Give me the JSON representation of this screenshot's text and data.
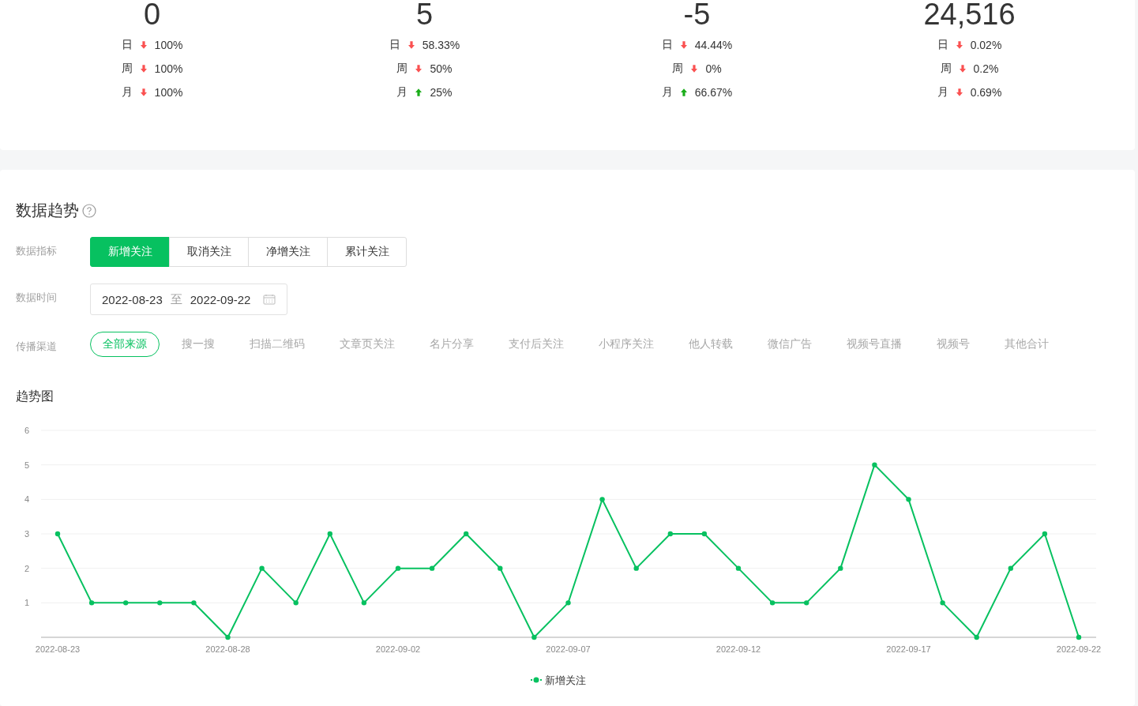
{
  "stats": [
    {
      "value": "0",
      "changes": [
        {
          "period": "日",
          "kind": "down",
          "value": "100%"
        },
        {
          "period": "周",
          "kind": "down",
          "value": "100%"
        },
        {
          "period": "月",
          "kind": "down",
          "value": "100%"
        }
      ]
    },
    {
      "value": "5",
      "changes": [
        {
          "period": "日",
          "kind": "down",
          "value": "58.33%"
        },
        {
          "period": "周",
          "kind": "down",
          "value": "50%"
        },
        {
          "period": "月",
          "kind": "up",
          "value": "25%"
        }
      ]
    },
    {
      "value": "-5",
      "changes": [
        {
          "period": "日",
          "kind": "down",
          "value": "44.44%"
        },
        {
          "period": "周",
          "kind": "down",
          "value": "0%"
        },
        {
          "period": "月",
          "kind": "up",
          "value": "66.67%"
        }
      ]
    },
    {
      "value": "24,516",
      "changes": [
        {
          "period": "日",
          "kind": "down",
          "value": "0.02%"
        },
        {
          "period": "周",
          "kind": "down",
          "value": "0.2%"
        },
        {
          "period": "月",
          "kind": "down",
          "value": "0.69%"
        }
      ]
    }
  ],
  "trend": {
    "title": "数据趋势",
    "metric": {
      "label": "数据指标",
      "options": [
        {
          "label": "新增关注",
          "selected": true
        },
        {
          "label": "取消关注",
          "selected": false
        },
        {
          "label": "净增关注",
          "selected": false
        },
        {
          "label": "累计关注",
          "selected": false
        }
      ]
    },
    "date": {
      "label": "数据时间",
      "start": "2022-08-23",
      "separator": "至",
      "end": "2022-09-22"
    },
    "channel": {
      "label": "传播渠道",
      "options": [
        {
          "label": "全部来源",
          "selected": true
        },
        {
          "label": "搜一搜",
          "selected": false
        },
        {
          "label": "扫描二维码",
          "selected": false
        },
        {
          "label": "文章页关注",
          "selected": false
        },
        {
          "label": "名片分享",
          "selected": false
        },
        {
          "label": "支付后关注",
          "selected": false
        },
        {
          "label": "小程序关注",
          "selected": false
        },
        {
          "label": "他人转载",
          "selected": false
        },
        {
          "label": "微信广告",
          "selected": false
        },
        {
          "label": "视频号直播",
          "selected": false
        },
        {
          "label": "视频号",
          "selected": false
        },
        {
          "label": "其他合计",
          "selected": false
        }
      ]
    },
    "chart_title": "趋势图",
    "chart_data": {
      "type": "line",
      "categories": [
        "2022-08-23",
        null,
        null,
        null,
        null,
        "2022-08-28",
        null,
        null,
        null,
        null,
        "2022-09-02",
        null,
        null,
        null,
        null,
        "2022-09-07",
        null,
        null,
        null,
        null,
        "2022-09-12",
        null,
        null,
        null,
        null,
        "2022-09-17",
        null,
        null,
        null,
        null,
        "2022-09-22"
      ],
      "ylim": [
        0,
        6
      ],
      "yticks": [
        1,
        2,
        3,
        4,
        5,
        6
      ],
      "grid": true,
      "series": [
        {
          "name": "新增关注",
          "color": "#07c160",
          "marker": "circle",
          "values": [
            3,
            1,
            1,
            1,
            1,
            0,
            2,
            1,
            3,
            1,
            2,
            2,
            3,
            2,
            0,
            1,
            4,
            2,
            3,
            3,
            2,
            1,
            1,
            2,
            5,
            4,
            1,
            0,
            2,
            3,
            0
          ]
        }
      ]
    }
  }
}
